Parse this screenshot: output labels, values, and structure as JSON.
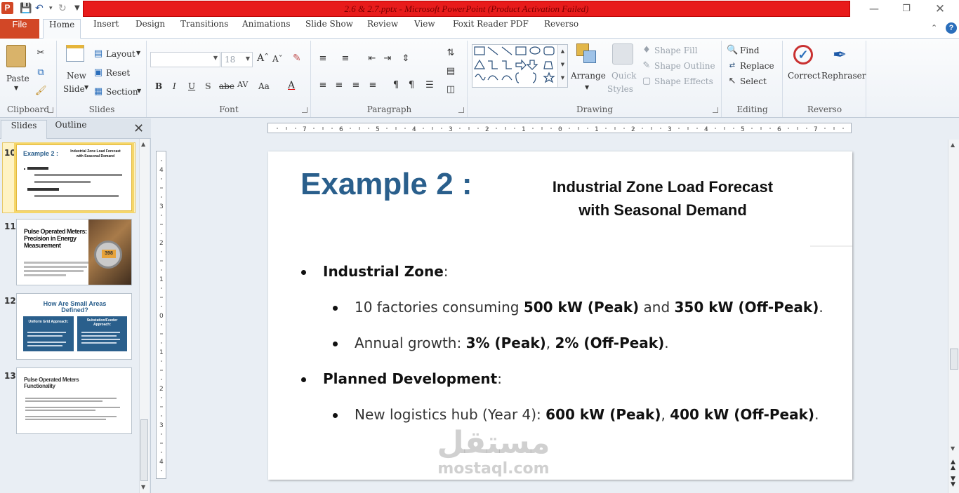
{
  "window": {
    "title": "2.6  & 2.7.pptx  -  Microsoft PowerPoint (Product Activation Failed)",
    "app_icon_letter": "P"
  },
  "tabs": [
    "Home",
    "Insert",
    "Design",
    "Transitions",
    "Animations",
    "Slide Show",
    "Review",
    "View",
    "Foxit Reader PDF",
    "Reverso"
  ],
  "file_tab": "File",
  "ribbon": {
    "clipboard": {
      "label": "Clipboard",
      "paste": "Paste"
    },
    "slides": {
      "label": "Slides",
      "new_slide_1": "New",
      "new_slide_2": "Slide",
      "layout": "Layout",
      "reset": "Reset",
      "section": "Section"
    },
    "font": {
      "label": "Font",
      "size": "18",
      "bold": "B",
      "italic": "I",
      "underline": "U",
      "shadow": "S",
      "strike": "abc",
      "spacing": "AV",
      "case": "Aa",
      "color": "A"
    },
    "paragraph": {
      "label": "Paragraph"
    },
    "drawing": {
      "label": "Drawing",
      "arrange": "Arrange",
      "quick_styles_1": "Quick",
      "quick_styles_2": "Styles",
      "shape_fill": "Shape Fill",
      "shape_outline": "Shape Outline",
      "shape_effects": "Shape Effects"
    },
    "editing": {
      "label": "Editing",
      "find": "Find",
      "replace": "Replace",
      "select": "Select"
    },
    "reverso": {
      "label": "Reverso",
      "correct": "Correct",
      "rephraser": "Rephraser"
    }
  },
  "pane": {
    "tab_slides": "Slides",
    "tab_outline": "Outline",
    "thumbs": [
      {
        "num": "10",
        "title": "Example 2 :",
        "subtitle": "Industrial Zone Load Forecast with Seasonal Demand"
      },
      {
        "num": "11",
        "title": "Pulse Operated Meters: Precision in Energy Measurement"
      },
      {
        "num": "12",
        "title": "How Are Small Areas Defined?",
        "col1": "Uniform Grid Approach:",
        "col2": "Substation/Feeder Approach:"
      },
      {
        "num": "13",
        "title": "Pulse Operated Meters Functionality"
      }
    ]
  },
  "slide": {
    "title": "Example 2 :",
    "subtitle_1": "Industrial Zone Load Forecast",
    "subtitle_2": "with Seasonal Demand",
    "b1": "Industrial Zone",
    "b1_1_a": "10 factories consuming ",
    "b1_1_b": "500 kW (Peak)",
    "b1_1_c": " and ",
    "b1_1_d": "350 kW (Off-Peak)",
    "b1_1_e": ".",
    "b1_2_a": "Annual growth: ",
    "b1_2_b": "3% (Peak)",
    "b1_2_c": ", ",
    "b1_2_d": "2% (Off-Peak)",
    "b1_2_e": ".",
    "b2": "Planned Development",
    "b2_1_a": "New logistics hub (Year 4): ",
    "b2_1_b": "600 kW (Peak)",
    "b2_1_c": ", ",
    "b2_1_d": "400 kW (Off-Peak)",
    "b2_1_e": ".",
    "colon": ":"
  },
  "watermark": {
    "ar": "مستقل",
    "en": "mostaql.com"
  },
  "ruler": {
    "h_ticks": [
      "7",
      "6",
      "5",
      "4",
      "3",
      "2",
      "1",
      "0",
      "1",
      "2",
      "3",
      "4",
      "5",
      "6",
      "7"
    ],
    "v_ticks": [
      "4",
      "3",
      "2",
      "1",
      "0",
      "1",
      "2",
      "3",
      "4"
    ]
  }
}
